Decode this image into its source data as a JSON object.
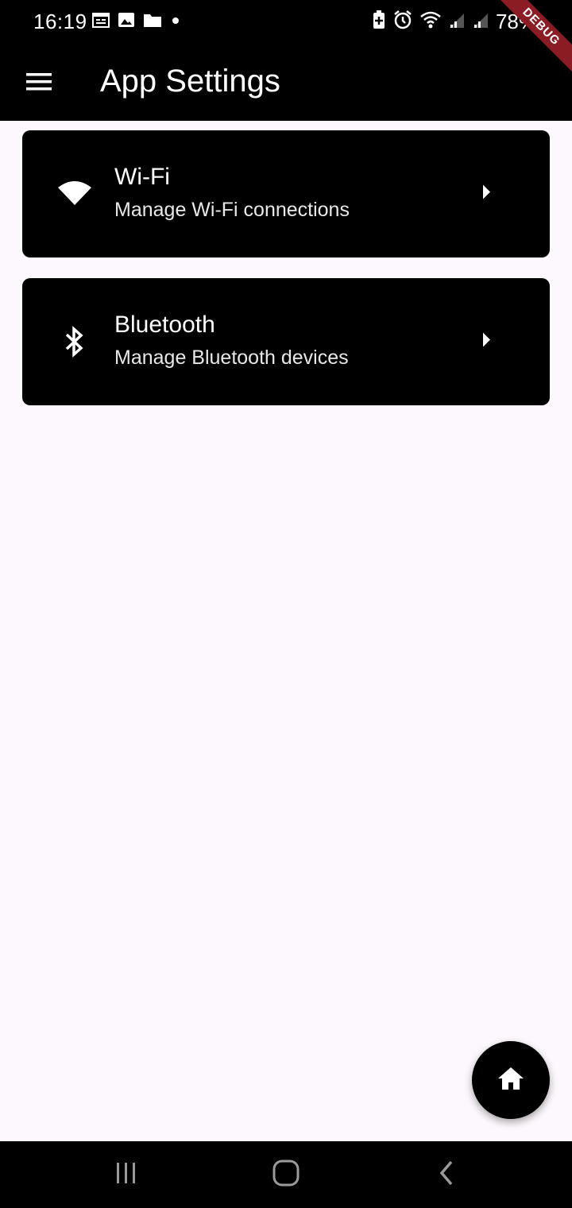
{
  "status_bar": {
    "time": "16:19",
    "battery": "78%",
    "left_icons": [
      "calendar-icon",
      "image-icon",
      "folder-icon",
      "dot-icon"
    ],
    "right_icons": [
      "battery-saver-icon",
      "alarm-icon",
      "wifi-icon",
      "signal-icon",
      "signal-icon"
    ]
  },
  "debug_banner": "DEBUG",
  "app_bar": {
    "title": "App Settings",
    "menu_icon": "hamburger-menu-icon"
  },
  "settings": [
    {
      "icon": "wifi-icon",
      "title": "Wi-Fi",
      "subtitle": "Manage Wi-Fi connections",
      "trailing_icon": "arrow-right-icon"
    },
    {
      "icon": "bluetooth-icon",
      "title": "Bluetooth",
      "subtitle": "Manage Bluetooth devices",
      "trailing_icon": "arrow-right-icon"
    }
  ],
  "fab": {
    "icon": "home-icon"
  },
  "nav_bar": {
    "buttons": [
      "recents-icon",
      "home-nav-icon",
      "back-icon"
    ]
  },
  "colors": {
    "background": "#fdf8fd",
    "primary": "#000000",
    "debug": "#8b1c24"
  }
}
